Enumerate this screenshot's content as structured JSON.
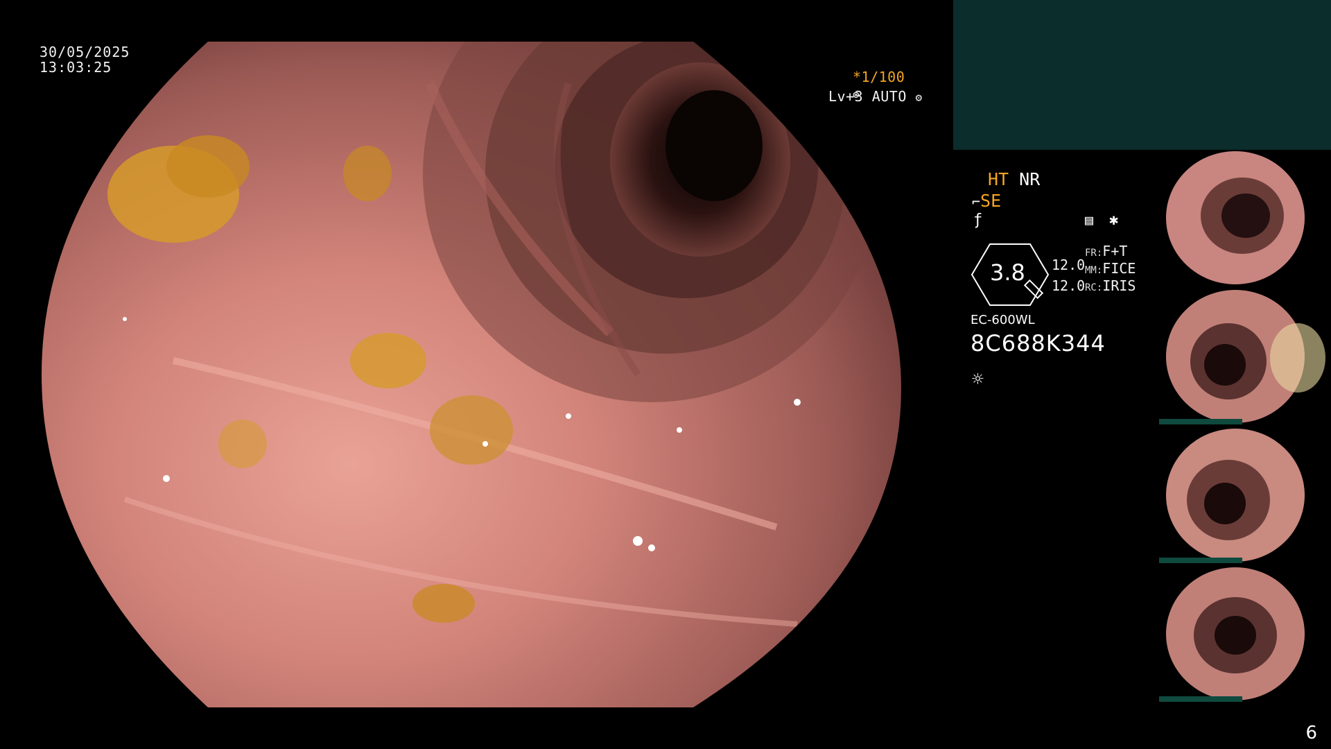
{
  "header": {
    "date": "30/05/2025",
    "time": "13:03:25"
  },
  "osd": {
    "shutter": "*1/100",
    "level": "Lv+3",
    "mode": "AUTO"
  },
  "settings": {
    "ht": "HT",
    "nr": "NR",
    "se": "SE",
    "gauge_value": "3.8",
    "value_a": "12.0",
    "value_b": "12.0",
    "fr_label": "FR:",
    "fr_value": "F+T",
    "mm_label": "MM:",
    "mm_value": "FICE",
    "rc_label": "RC:",
    "rc_value": "IRIS",
    "scope_model": "EC-600WL",
    "serial": "8C688K344"
  },
  "thumbnails": [
    {
      "name": "thumb-1"
    },
    {
      "name": "thumb-2"
    },
    {
      "name": "thumb-3"
    },
    {
      "name": "thumb-4"
    }
  ],
  "page": {
    "number": "6"
  },
  "colors": {
    "mucosa": "#c97a6f",
    "lumen": "#1a0d0c",
    "debris": "#d69a2c",
    "accent": "#f5a623",
    "panel": "#0b2d2b"
  },
  "icons": [
    "gear-icon",
    "aperture-icon",
    "lightbulb-sun-icon",
    "record-icon",
    "asterisk-icon",
    "gauge-icon",
    "se-icon",
    "f-icon"
  ]
}
